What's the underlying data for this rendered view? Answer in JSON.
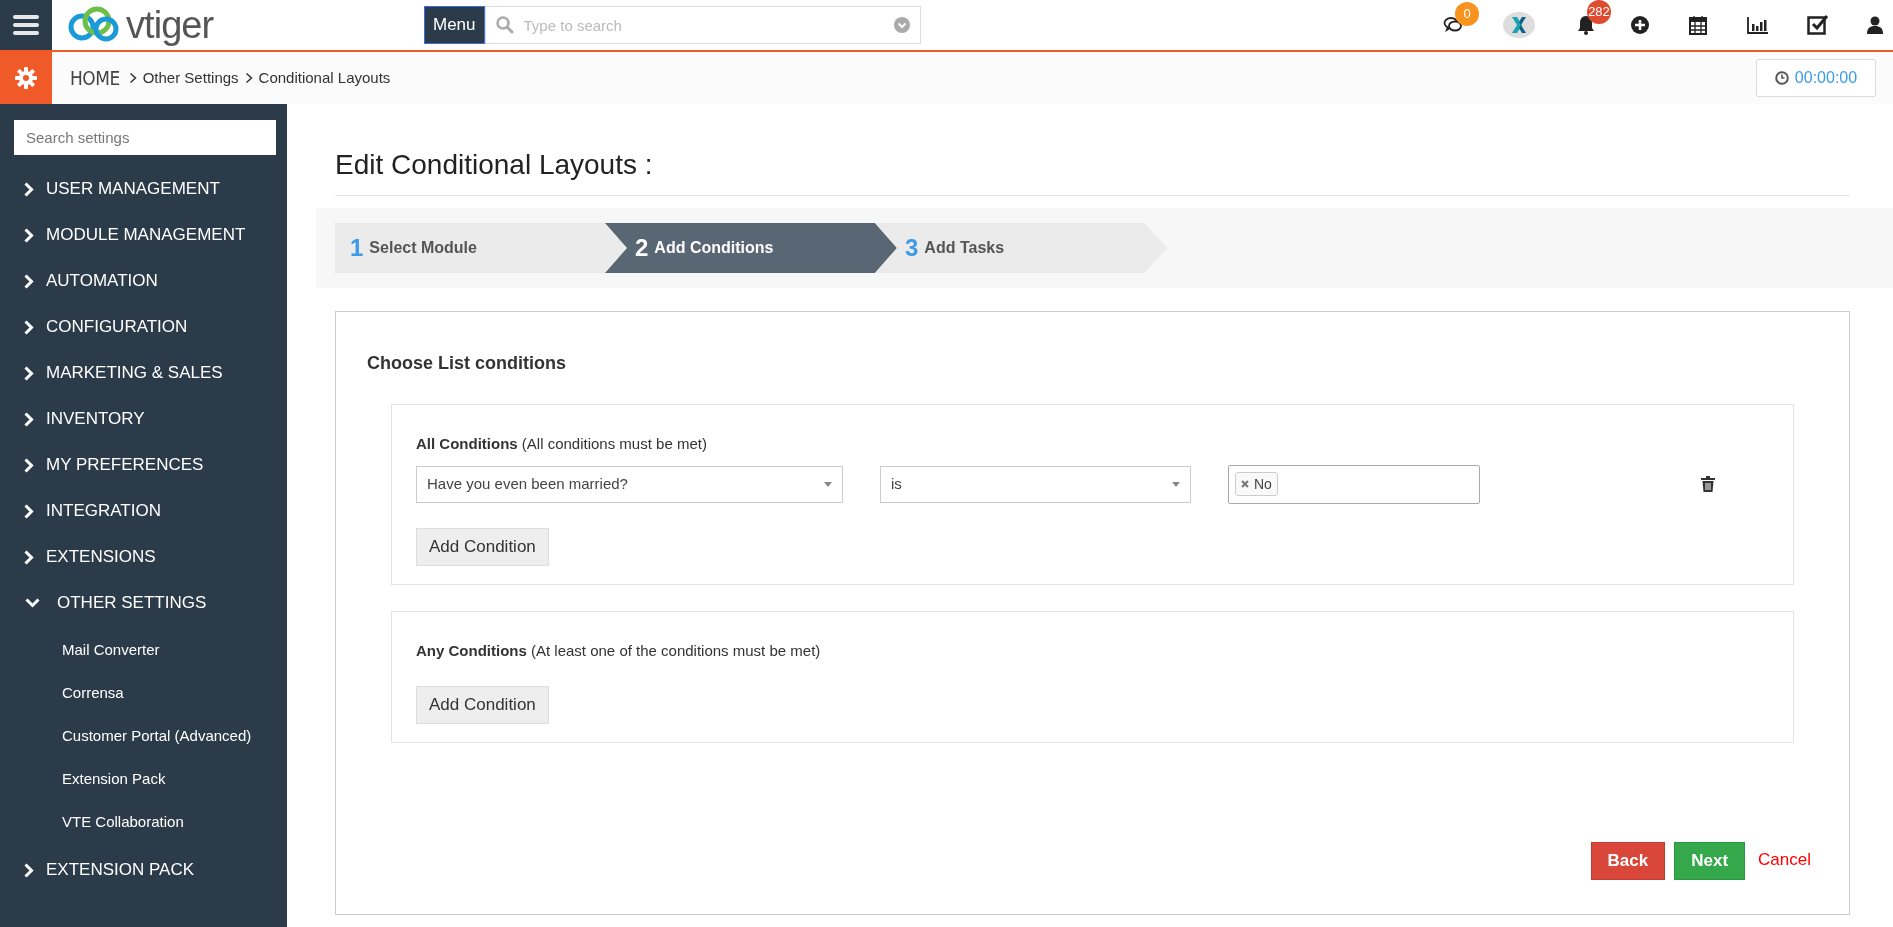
{
  "topbar": {
    "logo": "vtiger",
    "menu_button": "Menu",
    "search": {
      "placeholder": "Type to search"
    },
    "chat_badge": "0",
    "notification_badge": "282"
  },
  "breadcrumb": [
    "HOME",
    "Other Settings",
    "Conditional Layouts"
  ],
  "timer": "00:00:00",
  "sidebar": {
    "search": {
      "placeholder": "Search settings"
    },
    "items": [
      {
        "label": "USER MANAGEMENT",
        "expanded": false
      },
      {
        "label": "MODULE MANAGEMENT",
        "expanded": false
      },
      {
        "label": "AUTOMATION",
        "expanded": false
      },
      {
        "label": "CONFIGURATION",
        "expanded": false
      },
      {
        "label": "MARKETING & SALES",
        "expanded": false
      },
      {
        "label": "INVENTORY",
        "expanded": false
      },
      {
        "label": "MY PREFERENCES",
        "expanded": false
      },
      {
        "label": "INTEGRATION",
        "expanded": false
      },
      {
        "label": "EXTENSIONS",
        "expanded": false
      },
      {
        "label": "OTHER SETTINGS",
        "expanded": true,
        "children": [
          {
            "label": "Mail Converter"
          },
          {
            "label": "Corrensa"
          },
          {
            "label": "Customer Portal (Advanced)"
          },
          {
            "label": "Extension Pack"
          },
          {
            "label": "VTE Collaboration"
          }
        ]
      },
      {
        "label": "EXTENSION PACK",
        "expanded": false
      }
    ]
  },
  "page_title": "Edit Conditional Layouts :",
  "steps": [
    {
      "number": "1",
      "label": "Select Module",
      "selected": false
    },
    {
      "number": "2",
      "label": "Add Conditions",
      "selected": true
    },
    {
      "number": "3",
      "label": "Add Tasks",
      "selected": false
    }
  ],
  "form": {
    "heading": "Choose List conditions",
    "groups": [
      {
        "title": "**All Conditions** (All conditions must be met)",
        "conditions": [
          {
            "field": "Have you even been married?",
            "operator": "is",
            "values": [
              "No"
            ]
          }
        ],
        "add_button": "Add Condition"
      },
      {
        "title": "**Any Conditions** (At least one of the conditions must be met)",
        "add_button": "Add Condition"
      }
    ]
  },
  "buttons": [
    {
      "label": "Back",
      "kind": "danger"
    },
    {
      "label": "Next",
      "kind": "success"
    },
    {
      "label": "Cancel",
      "kind": "link"
    }
  ]
}
